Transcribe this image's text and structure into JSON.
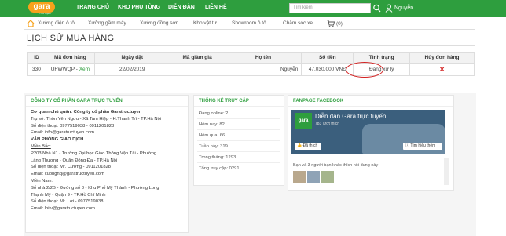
{
  "header": {
    "logo_text": "gara",
    "logo_sub": "Trực tuyến",
    "nav": [
      "TRANG CHỦ",
      "KHO PHỤ TÙNG",
      "DIỄN ĐÀN",
      "LIÊN HỆ"
    ],
    "search_placeholder": "Tìm kiếm",
    "user_name": "Nguyễn"
  },
  "subnav": {
    "items": [
      "Xưởng điện ô tô",
      "Xưởng gầm máy",
      "Xưởng đồng sơn",
      "Kho vật tư",
      "Showroom ô tô",
      "Chăm sóc xe"
    ],
    "cart_count": "(0)"
  },
  "page_title": "LỊCH SỬ MUA HÀNG",
  "orders_table": {
    "headers": [
      "ID",
      "Mã đơn hàng",
      "Ngày đặt",
      "Mã giảm giá",
      "Họ tên",
      "Số tiền",
      "Tình trạng",
      "Hủy đơn hàng"
    ],
    "row": {
      "id": "330",
      "code": "UFWWQP",
      "view_link": "Xem",
      "date": "22/02/2019",
      "coupon": "",
      "name": "Nguyễn",
      "amount": "47.030.000 VNĐ",
      "status": "Đang xử lý",
      "cancel_icon": "x-icon"
    }
  },
  "company": {
    "title": "CÔNG TY CỔ PHẦN GARA TRỰC TUYẾN",
    "lines": [
      "Cơ quan chủ quản: Công ty cổ phần Garatructuyen",
      "Trụ sở: Thôn Yên Ngưu - Xã Tam Hiệp - H.Thanh Trì - TP.Hà Nội",
      "Số điện thoại: 0977519038 - 0911201828",
      "Email: info@garatructuyen.com",
      "VĂN PHÒNG GIAO DỊCH",
      "Miền Bắc:",
      "P203 Nhà N1 - Trường Đại học Giao Thông Vận Tải - Phường",
      "Láng Thượng - Quận Đống Đa - TP.Hà Nội",
      "Số điện thoại: Mr. Cường - 0911201828",
      "Email: cuongnq@garatructuyen.com",
      "Miền Nam:",
      "Số nhà 2/2B - Đường số 8 - Khu Phố Mỹ Thành - Phường Long",
      "Thạnh Mỹ - Quận 9 - TP.Hồ Chí Minh",
      "Số điện thoại:  Mr. Lợi - 0977519038",
      "Email: loitv@garatructuyen.com"
    ]
  },
  "stats": {
    "title": "THỐNG KÊ TRUY CẬP",
    "lines": [
      "Đang online: 2",
      "Hôm nay: 82",
      "Hôm qua: 66",
      "Tuần này: 319",
      "Trong tháng: 1293",
      "Tổng truy cập: 0291"
    ]
  },
  "fanpage": {
    "title": "FANPAGE FACEBOOK",
    "logo_text": "gara",
    "page_name": "Diễn đàn Gara trực tuyến",
    "likes": "783 lượt thích",
    "like_button": "Đã thích",
    "learn_button": "Tìm hiểu thêm",
    "friends_text": "Bạn và 3 người bạn khác thích nội dung này"
  },
  "colors": {
    "brand_green": "#2e9e3e",
    "status_circle": "#d21f1f",
    "logo_orange": "#f7a21b"
  }
}
